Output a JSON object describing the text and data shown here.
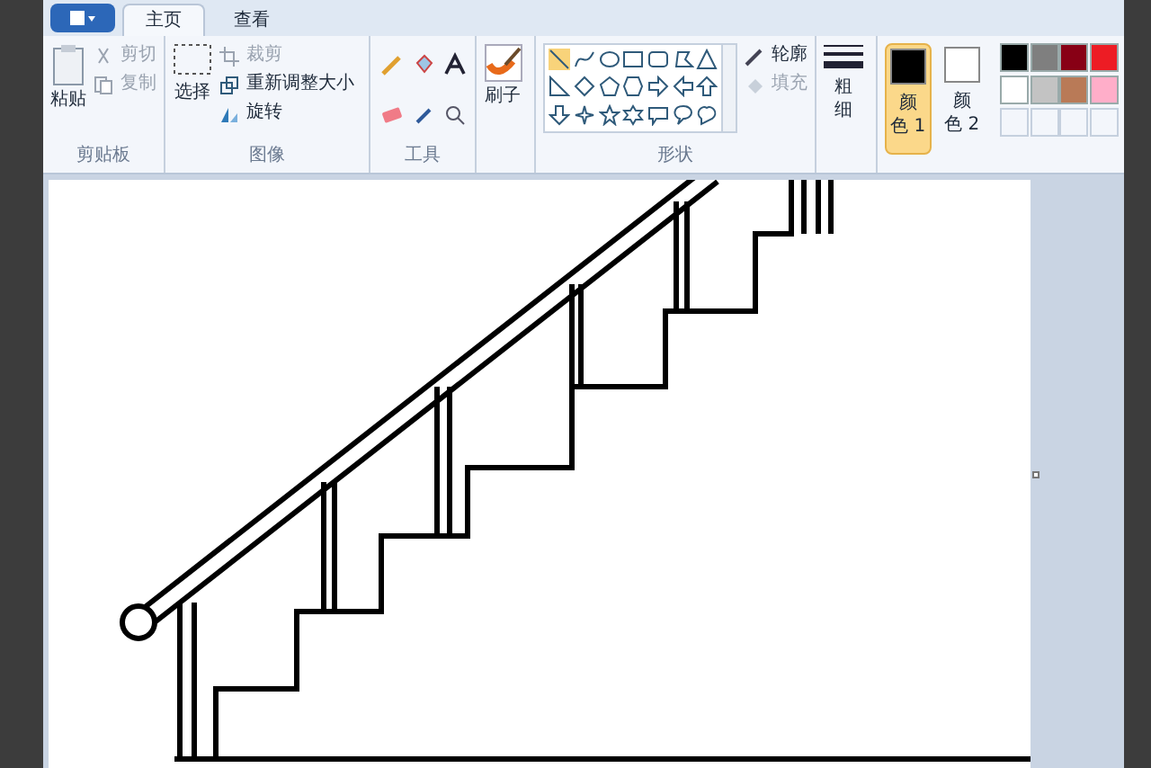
{
  "tabs": [
    {
      "label": "主页",
      "selected": true
    },
    {
      "label": "查看",
      "selected": false
    }
  ],
  "clipboard": {
    "paste": "粘贴",
    "cut": {
      "label": "剪切",
      "disabled": true
    },
    "copy": {
      "label": "复制",
      "disabled": true
    },
    "group": "剪贴板"
  },
  "image": {
    "select": "选择",
    "crop": {
      "label": "裁剪",
      "disabled": true
    },
    "resize": {
      "label": "重新调整大小",
      "disabled": false
    },
    "rotate": {
      "label": "旋转",
      "disabled": false
    },
    "group": "图像"
  },
  "tools": {
    "group": "工具"
  },
  "brush": {
    "label": "刷子"
  },
  "shapes": {
    "outline": {
      "label": "轮廓",
      "disabled": false
    },
    "fill": {
      "label": "填充",
      "disabled": true
    },
    "group": "形状"
  },
  "size": {
    "label_1": "粗",
    "label_2": "细"
  },
  "colors": [
    {
      "label_1": "颜",
      "label_2": "色 1",
      "selected": true,
      "color": "#000000"
    },
    {
      "label_1": "颜",
      "label_2": "色 2",
      "selected": false,
      "color": "#ffffff"
    }
  ],
  "palette": [
    {
      "color": "#000000"
    },
    {
      "color": "#7f7f7f"
    },
    {
      "color": "#880015"
    },
    {
      "color": "#ed1c24"
    },
    {
      "color": "#ffffff"
    },
    {
      "color": "#c3c3c3"
    },
    {
      "color": "#b97a57"
    },
    {
      "color": "#ffaec9"
    }
  ]
}
